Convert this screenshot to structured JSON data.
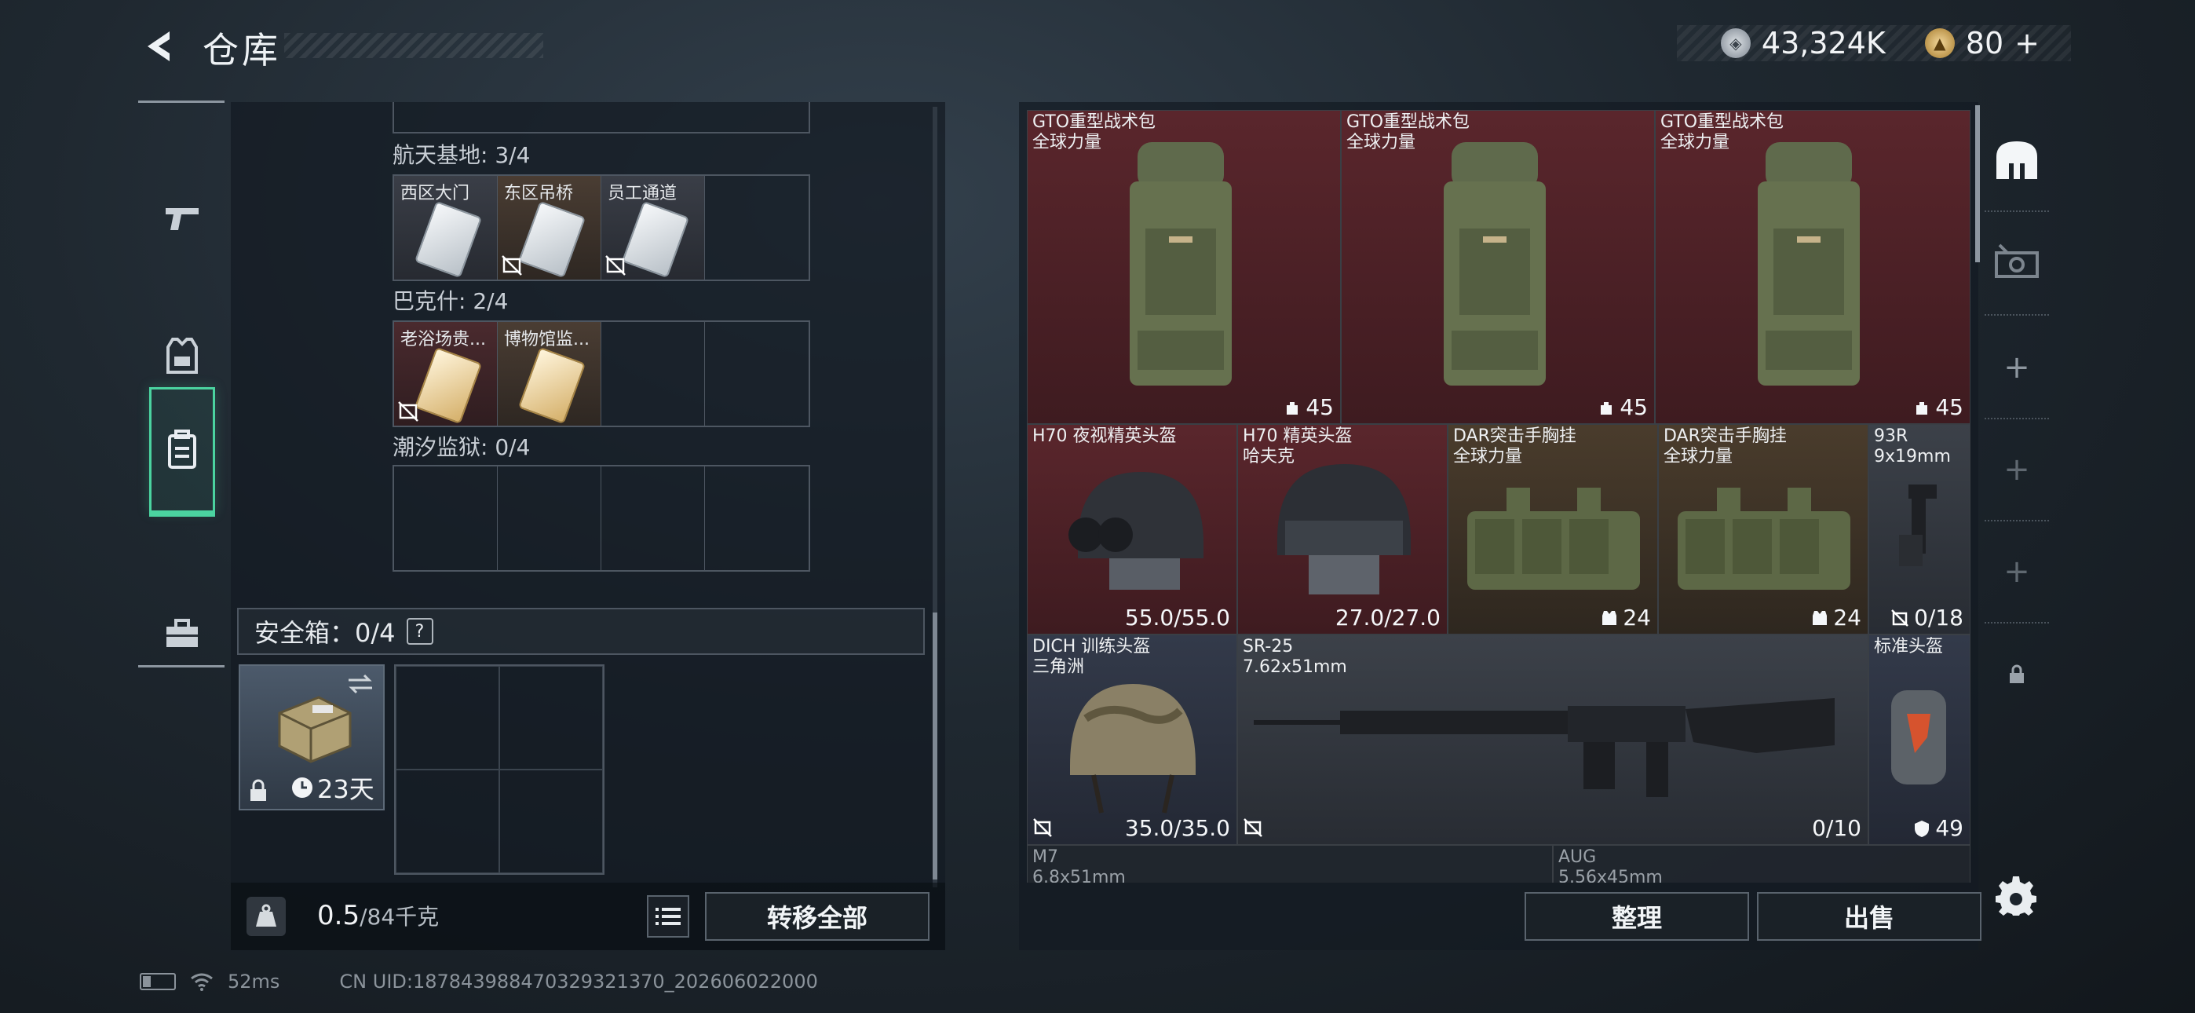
{
  "header": {
    "title": "仓库"
  },
  "currency": {
    "silver_amount": "43,324K",
    "gold_amount": "80",
    "gold_plus": "+"
  },
  "left_tabs": [
    "weapons",
    "equipment",
    "inventory",
    "toolbox"
  ],
  "keys": {
    "groups": [
      {
        "title": "航天基地: 3/4",
        "items": [
          {
            "name": "西区大门",
            "usable": true
          },
          {
            "name": "东区吊桥",
            "usable": false
          },
          {
            "name": "员工通道",
            "usable": false
          }
        ]
      },
      {
        "title": "巴克什: 2/4",
        "items": [
          {
            "name": "老浴场贵...",
            "usable": false
          },
          {
            "name": "博物馆监...",
            "usable": true
          }
        ]
      },
      {
        "title": "潮汐监狱: 0/4",
        "items": []
      }
    ]
  },
  "safe": {
    "title": "安全箱：0/4",
    "help": "?",
    "timer": "23天"
  },
  "weight": {
    "current": "0.5",
    "max": "/84千克"
  },
  "buttons": {
    "transfer_all": "转移全部",
    "sort": "整理",
    "sell": "出售"
  },
  "stash": [
    {
      "name": "GTO重型战术包",
      "sub": "全球力量",
      "value": "45"
    },
    {
      "name": "GTO重型战术包",
      "sub": "全球力量",
      "value": "45"
    },
    {
      "name": "GTO重型战术包",
      "sub": "全球力量",
      "value": "45"
    },
    {
      "name": "H70 夜视精英头盔",
      "sub": "",
      "value": "55.0/55.0"
    },
    {
      "name": "H70 精英头盔",
      "sub": "哈夫克",
      "value": "27.0/27.0"
    },
    {
      "name": "DAR突击手胸挂",
      "sub": "全球力量",
      "value": "24"
    },
    {
      "name": "DAR突击手胸挂",
      "sub": "全球力量",
      "value": "24"
    },
    {
      "name": "93R",
      "sub": "9x19mm",
      "value": "0/18"
    },
    {
      "name": "DICH 训练头盔",
      "sub": "三角洲",
      "value": "35.0/35.0"
    },
    {
      "name": "SR-25",
      "sub": "7.62x51mm",
      "value": "0/10"
    },
    {
      "name": "标准头盔",
      "sub": "",
      "value": "49"
    },
    {
      "name": "M7",
      "sub": "6.8x51mm",
      "value": ""
    },
    {
      "name": "AUG",
      "sub": "5.56x45mm",
      "value": ""
    }
  ],
  "status": {
    "ping": "52ms",
    "uid": "CN UID:187843988470329321370_202606022000"
  }
}
